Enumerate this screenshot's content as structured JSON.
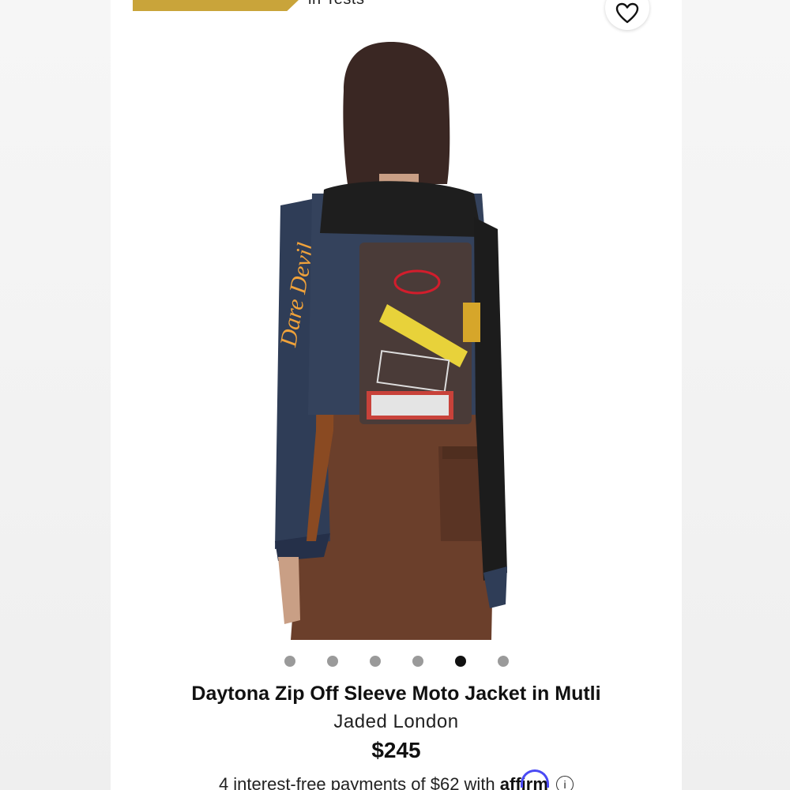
{
  "promo": {
    "text": "in Tests"
  },
  "wishlist": {
    "icon": "heart-icon"
  },
  "carousel": {
    "count": 6,
    "active_index": 4
  },
  "product": {
    "title": "Daytona Zip Off Sleeve Moto Jacket in Mutli",
    "brand": "Jaded London",
    "price": "$245"
  },
  "payments": {
    "text": "4 interest-free payments of $62 with",
    "provider": "affirm",
    "info_icon": "info-icon"
  },
  "colors": {
    "promo_banner": "#c9a43a",
    "dot_active": "#111111",
    "dot_inactive": "#9a9a9a",
    "affirm_accent": "#4a4af4"
  }
}
